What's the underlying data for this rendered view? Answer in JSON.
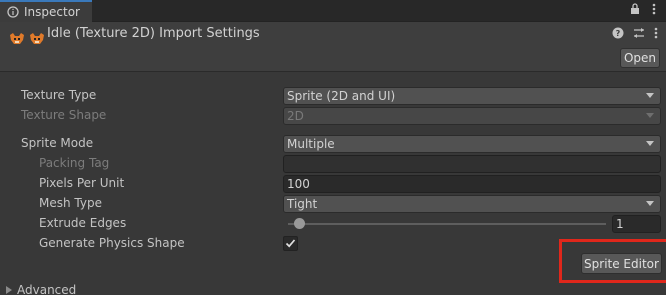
{
  "tab": {
    "label": "Inspector"
  },
  "header": {
    "title": "Idle (Texture 2D) Import Settings",
    "open_label": "Open"
  },
  "properties": {
    "texture_type": {
      "label": "Texture Type",
      "value": "Sprite (2D and UI)"
    },
    "texture_shape": {
      "label": "Texture Shape",
      "value": "2D"
    },
    "sprite_mode": {
      "label": "Sprite Mode",
      "value": "Multiple"
    },
    "packing_tag": {
      "label": "Packing Tag",
      "value": ""
    },
    "pixels_per_unit": {
      "label": "Pixels Per Unit",
      "value": "100"
    },
    "mesh_type": {
      "label": "Mesh Type",
      "value": "Tight"
    },
    "extrude_edges": {
      "label": "Extrude Edges",
      "value": "1"
    },
    "generate_physics_shape": {
      "label": "Generate Physics Shape",
      "checked": true
    }
  },
  "sprite_editor_label": "Sprite Editor",
  "advanced_label": "Advanced",
  "colors": {
    "tab_accent": "#3a79bb",
    "highlight": "#e0271b"
  }
}
